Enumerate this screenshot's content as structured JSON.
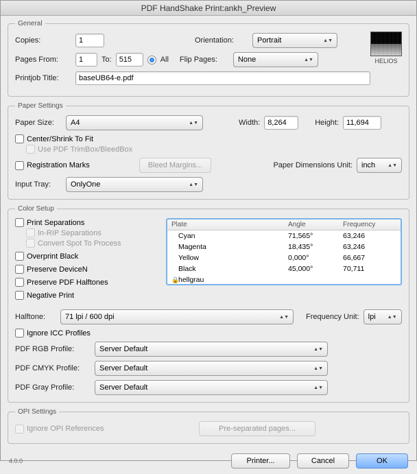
{
  "window": {
    "title": "PDF HandShake Print:ankh_Preview"
  },
  "logo": "HELIOS",
  "general": {
    "legend": "General",
    "copies_label": "Copies:",
    "copies_value": "1",
    "orientation_label": "Orientation:",
    "orientation_value": "Portrait",
    "pages_from_label": "Pages From:",
    "pages_from_value": "1",
    "to_label": "To:",
    "to_value": "515",
    "all_label": "All",
    "flip_label": "Flip Pages:",
    "flip_value": "None",
    "job_title_label": "Printjob Title:",
    "job_title_value": "baseUB64-e.pdf"
  },
  "paper": {
    "legend": "Paper Settings",
    "size_label": "Paper Size:",
    "size_value": "A4",
    "width_label": "Width:",
    "width_value": "8,264",
    "height_label": "Height:",
    "height_value": "11,694",
    "center_label": "Center/Shrink To Fit",
    "trimbox_label": "Use PDF TrimBox/BleedBox",
    "reg_label": "Registration Marks",
    "bleed_btn": "Bleed Margins...",
    "dim_unit_label": "Paper Dimensions Unit:",
    "dim_unit_value": "inch",
    "tray_label": "Input Tray:",
    "tray_value": "OnlyOne"
  },
  "color": {
    "legend": "Color Setup",
    "print_sep_label": "Print Separations",
    "inrip_label": "In-RIP Separations",
    "convert_spot_label": "Convert Spot To Process",
    "overprint_label": "Overprint Black",
    "preserve_devn_label": "Preserve DeviceN",
    "preserve_hal_label": "Preserve PDF Halftones",
    "neg_label": "Negative Print",
    "halftone_label": "Halftone:",
    "halftone_value": "71 lpi / 600 dpi",
    "freq_unit_label": "Frequency Unit:",
    "freq_unit_value": "lpi",
    "ignore_icc_label": "Ignore ICC Profiles",
    "rgb_label": "PDF RGB Profile:",
    "rgb_value": "Server Default",
    "cmyk_label": "PDF CMYK Profile:",
    "cmyk_value": "Server Default",
    "gray_label": "PDF Gray Profile:",
    "gray_value": "Server Default",
    "plate_headers": {
      "plate": "Plate",
      "angle": "Angle",
      "freq": "Frequency"
    },
    "plates": [
      {
        "name": "Cyan",
        "angle": "71,565°",
        "freq": "63,246"
      },
      {
        "name": "Magenta",
        "angle": "18,435°",
        "freq": "63,246"
      },
      {
        "name": "Yellow",
        "angle": "0,000°",
        "freq": "66,667"
      },
      {
        "name": "Black",
        "angle": "45,000°",
        "freq": "70,711"
      },
      {
        "name": "hellgrau",
        "angle": "",
        "freq": "",
        "locked": true
      }
    ]
  },
  "opi": {
    "legend": "OPI Settings",
    "ignore_opi_label": "Ignore OPI References",
    "presep_btn": "Pre-separated pages..."
  },
  "footer": {
    "version": "4.0.0",
    "printer_btn": "Printer...",
    "cancel_btn": "Cancel",
    "ok_btn": "OK"
  }
}
